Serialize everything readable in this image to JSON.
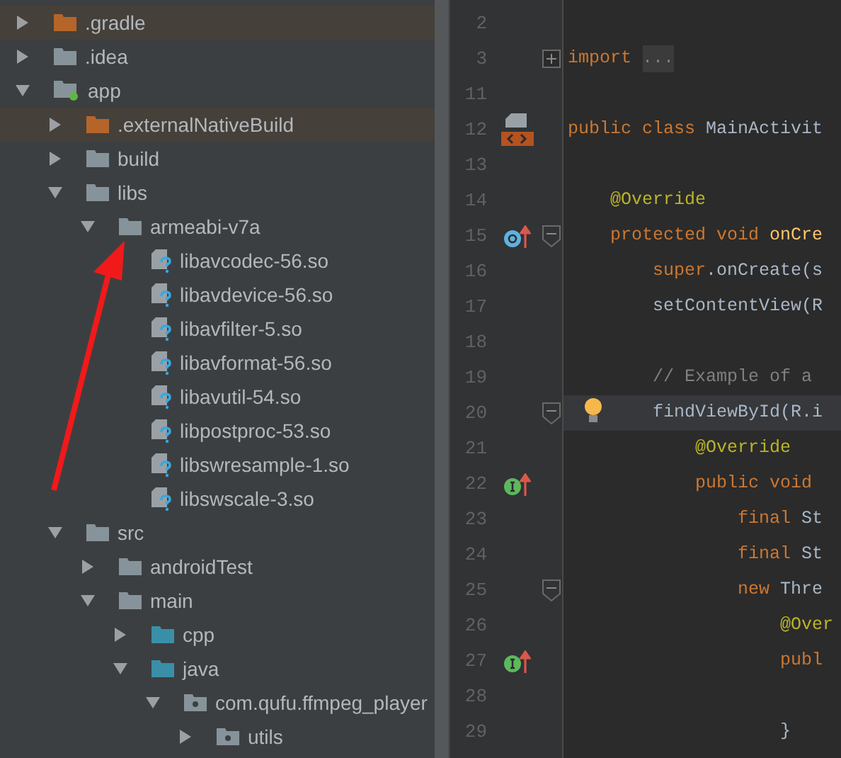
{
  "project_tree": [
    {
      "label": ".gradle",
      "kind": "excluded",
      "expanded": false
    },
    {
      "label": ".idea",
      "kind": "folder",
      "expanded": false
    },
    {
      "label": "app",
      "kind": "module",
      "expanded": true,
      "children": [
        {
          "label": ".externalNativeBuild",
          "kind": "excluded",
          "expanded": false
        },
        {
          "label": "build",
          "kind": "folder",
          "expanded": false
        },
        {
          "label": "libs",
          "kind": "folder",
          "expanded": true,
          "children": [
            {
              "label": "armeabi-v7a",
              "kind": "folder",
              "expanded": true,
              "children": [
                {
                  "label": "libavcodec-56.so",
                  "kind": "file"
                },
                {
                  "label": "libavdevice-56.so",
                  "kind": "file"
                },
                {
                  "label": "libavfilter-5.so",
                  "kind": "file"
                },
                {
                  "label": "libavformat-56.so",
                  "kind": "file"
                },
                {
                  "label": "libavutil-54.so",
                  "kind": "file"
                },
                {
                  "label": "libpostproc-53.so",
                  "kind": "file"
                },
                {
                  "label": "libswresample-1.so",
                  "kind": "file"
                },
                {
                  "label": "libswscale-3.so",
                  "kind": "file"
                }
              ]
            }
          ]
        },
        {
          "label": "src",
          "kind": "folder",
          "expanded": true,
          "children": [
            {
              "label": "androidTest",
              "kind": "folder",
              "expanded": false
            },
            {
              "label": "main",
              "kind": "folder",
              "expanded": true,
              "children": [
                {
                  "label": "cpp",
                  "kind": "source",
                  "expanded": false
                },
                {
                  "label": "java",
                  "kind": "source",
                  "expanded": true,
                  "children": [
                    {
                      "label": "com.qufu.ffmpeg_player",
                      "kind": "package",
                      "expanded": true,
                      "children": [
                        {
                          "label": "utils",
                          "kind": "package",
                          "expanded": false
                        }
                      ]
                    }
                  ]
                }
              ]
            }
          ]
        }
      ]
    }
  ],
  "editor": {
    "lines": [
      {
        "number": "2"
      },
      {
        "number": "3",
        "fold_marker": {
          "kind": "expand"
        },
        "tokens": [
          {
            "t": "import",
            "kind": "keyword"
          }
        ],
        "folded": "..."
      },
      {
        "number": "11"
      },
      {
        "number": "12",
        "gutter_icon": {
          "kind": "layout"
        },
        "tokens": [
          {
            "t": "public class ",
            "kind": "keyword"
          },
          {
            "t": "MainActivit",
            "kind": "plain"
          }
        ],
        "children": [
          {
            "number": "13"
          },
          {
            "number": "14",
            "tokens": [
              {
                "t": "@Override",
                "kind": "annotation"
              }
            ]
          },
          {
            "number": "15",
            "gutter_icon": {
              "kind": "overrides"
            },
            "fold_marker": {
              "kind": "collapse"
            },
            "tokens": [
              {
                "t": "protected void ",
                "kind": "keyword"
              },
              {
                "t": "onCre",
                "kind": "method"
              }
            ],
            "children": [
              {
                "number": "16",
                "tokens": [
                  {
                    "t": "super",
                    "kind": "keyword"
                  },
                  {
                    "t": ".onCreate(s",
                    "kind": "plain"
                  }
                ]
              },
              {
                "number": "17",
                "tokens": [
                  {
                    "t": "setContentView(R",
                    "kind": "plain"
                  }
                ]
              },
              {
                "number": "18"
              },
              {
                "number": "19",
                "tokens": [
                  {
                    "t": "// Example of a",
                    "kind": "comment"
                  }
                ]
              },
              {
                "number": "20",
                "current": true,
                "hint": true,
                "fold_marker": {
                  "kind": "collapse"
                },
                "tokens": [
                  {
                    "t": "findViewById(R.i",
                    "kind": "plain"
                  }
                ],
                "children": [
                  {
                    "number": "21",
                    "tokens": [
                      {
                        "t": "@Override",
                        "kind": "annotation"
                      }
                    ]
                  },
                  {
                    "number": "22",
                    "gutter_icon": {
                      "kind": "implements"
                    },
                    "tokens": [
                      {
                        "t": "public void",
                        "kind": "keyword"
                      }
                    ],
                    "children": [
                      {
                        "number": "23",
                        "tokens": [
                          {
                            "t": "final ",
                            "kind": "keyword"
                          },
                          {
                            "t": "St",
                            "kind": "plain"
                          }
                        ]
                      },
                      {
                        "number": "24",
                        "tokens": [
                          {
                            "t": "final ",
                            "kind": "keyword"
                          },
                          {
                            "t": "St",
                            "kind": "plain"
                          }
                        ]
                      },
                      {
                        "number": "25",
                        "fold_marker": {
                          "kind": "collapse"
                        },
                        "tokens": [
                          {
                            "t": "new ",
                            "kind": "keyword"
                          },
                          {
                            "t": "Thre",
                            "kind": "plain"
                          }
                        ],
                        "children": [
                          {
                            "number": "26",
                            "tokens": [
                              {
                                "t": "@Over",
                                "kind": "annotation"
                              }
                            ]
                          },
                          {
                            "number": "27",
                            "gutter_icon": {
                              "kind": "implements"
                            },
                            "tokens": [
                              {
                                "t": "publ",
                                "kind": "keyword"
                              }
                            ],
                            "children": [
                              {
                                "number": "28"
                              }
                            ]
                          },
                          {
                            "number": "29",
                            "tokens": [
                              {
                                "t": "}",
                                "kind": "plain"
                              }
                            ]
                          }
                        ]
                      }
                    ]
                  }
                ]
              }
            ]
          }
        ]
      }
    ]
  }
}
